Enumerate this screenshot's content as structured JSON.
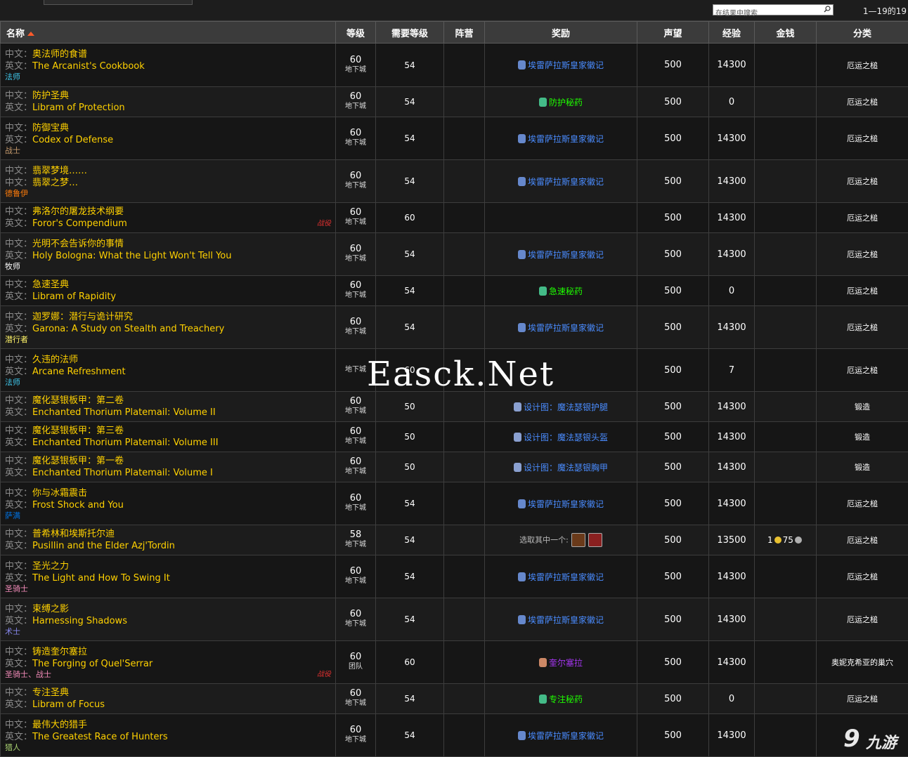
{
  "toolbar": {
    "search_placeholder": "在结果中搜索",
    "pager": "1—19的19"
  },
  "columns": [
    "名称",
    "等级",
    "需要等级",
    "阵营",
    "奖励",
    "声望",
    "经验",
    "金钱",
    "分类"
  ],
  "prefix": {
    "zh": "中文：",
    "en": "英文："
  },
  "rows": [
    {
      "zh": "奥法师的食谱",
      "en": "The Arcanist's Cookbook",
      "cls": "法师",
      "cls_color": "#3fc7eb",
      "tag": "",
      "level": "60",
      "level_sub": "地下城",
      "req": "54",
      "faction": "",
      "reward": "埃雷萨拉斯皇家徽记",
      "reward_color": "#4a8cff",
      "reward_icon": "#6688cc",
      "rep": "500",
      "xp": "14300",
      "money": "",
      "cat": "厄运之槌"
    },
    {
      "zh": "防护圣典",
      "en": "Libram of Protection",
      "pfx2": "英文：",
      "cls": "",
      "cls_color": "#fff",
      "tag": "",
      "level": "60",
      "level_sub": "地下城",
      "req": "54",
      "faction": "",
      "reward": "防护秘药",
      "reward_color": "#1eff00",
      "reward_icon": "#4b8",
      "rep": "500",
      "xp": "0",
      "money": "",
      "cat": "厄运之槌"
    },
    {
      "zh": "防御宝典",
      "en": "Codex of Defense",
      "cls": "战士",
      "cls_color": "#c69b6d",
      "tag": "",
      "level": "60",
      "level_sub": "地下城",
      "req": "54",
      "faction": "",
      "reward": "埃雷萨拉斯皇家徽记",
      "reward_color": "#4a8cff",
      "reward_icon": "#6688cc",
      "rep": "500",
      "xp": "14300",
      "money": "",
      "cat": "厄运之槌"
    },
    {
      "zh": "翡翠梦境……",
      "en": "翡翠之梦…",
      "en_pfx": "中文：",
      "cls": "德鲁伊",
      "cls_color": "#ff7c0a",
      "tag": "",
      "level": "60",
      "level_sub": "地下城",
      "req": "54",
      "faction": "",
      "reward": "埃雷萨拉斯皇家徽记",
      "reward_color": "#4a8cff",
      "reward_icon": "#6688cc",
      "rep": "500",
      "xp": "14300",
      "money": "",
      "cat": "厄运之槌"
    },
    {
      "zh": "弗洛尔的屠龙技术纲要",
      "en": "Foror's Compendium",
      "cls": "",
      "cls_color": "#fff",
      "tag": "战役",
      "level": "60",
      "level_sub": "地下城",
      "req": "60",
      "faction": "",
      "reward": "",
      "reward_color": "#4a8cff",
      "reward_icon": "",
      "rep": "500",
      "xp": "14300",
      "money": "",
      "cat": "厄运之槌"
    },
    {
      "zh": "光明不会告诉你的事情",
      "en": "Holy Bologna:  What the Light Won't Tell You",
      "cls": "牧师",
      "cls_color": "#ffffff",
      "tag": "",
      "level": "60",
      "level_sub": "地下城",
      "req": "54",
      "faction": "",
      "reward": "埃雷萨拉斯皇家徽记",
      "reward_color": "#4a8cff",
      "reward_icon": "#6688cc",
      "rep": "500",
      "xp": "14300",
      "money": "",
      "cat": "厄运之槌"
    },
    {
      "zh": "急速圣典",
      "en": "Libram of Rapidity",
      "cls": "",
      "cls_color": "#fff",
      "tag": "",
      "level": "60",
      "level_sub": "地下城",
      "req": "54",
      "faction": "",
      "reward": "急速秘药",
      "reward_color": "#1eff00",
      "reward_icon": "#4b8",
      "rep": "500",
      "xp": "0",
      "money": "",
      "cat": "厄运之槌"
    },
    {
      "zh": "迦罗娜：潜行与诡计研究",
      "en": "Garona:  A Study on Stealth and Treachery",
      "cls": "潜行者",
      "cls_color": "#fff468",
      "tag": "",
      "level": "60",
      "level_sub": "地下城",
      "req": "54",
      "faction": "",
      "reward": "埃雷萨拉斯皇家徽记",
      "reward_color": "#4a8cff",
      "reward_icon": "#6688cc",
      "rep": "500",
      "xp": "14300",
      "money": "",
      "cat": "厄运之槌"
    },
    {
      "zh": "久违的法师",
      "en": "Arcane Refreshment",
      "cls": "法师",
      "cls_color": "#3fc7eb",
      "tag": "",
      "level": "",
      "level_sub": "地下城",
      "req": "60",
      "faction": "",
      "reward": "",
      "reward_color": "#4a8cff",
      "reward_icon": "",
      "rep": "500",
      "xp": "7",
      "money": "",
      "cat": "厄运之槌"
    },
    {
      "zh": "魔化瑟银板甲：第二卷",
      "en": "Enchanted Thorium Platemail:  Volume II",
      "cls": "",
      "cls_color": "#fff",
      "tag": "",
      "level": "60",
      "level_sub": "地下城",
      "req": "50",
      "faction": "",
      "reward": "设计图：魔法瑟银护腿",
      "reward_color": "#4a8cff",
      "reward_icon": "#8aa0d0",
      "rep": "500",
      "xp": "14300",
      "money": "",
      "cat": "锻造"
    },
    {
      "zh": "魔化瑟银板甲：第三卷",
      "en": "Enchanted Thorium Platemail:  Volume III",
      "cls": "",
      "cls_color": "#fff",
      "tag": "",
      "level": "60",
      "level_sub": "地下城",
      "req": "50",
      "faction": "",
      "reward": "设计图：魔法瑟银头盔",
      "reward_color": "#4a8cff",
      "reward_icon": "#8aa0d0",
      "rep": "500",
      "xp": "14300",
      "money": "",
      "cat": "锻造"
    },
    {
      "zh": "魔化瑟银板甲：第一卷",
      "en": "Enchanted Thorium Platemail:  Volume I",
      "cls": "",
      "cls_color": "#fff",
      "tag": "",
      "level": "60",
      "level_sub": "地下城",
      "req": "50",
      "faction": "",
      "reward": "设计图：魔法瑟银胸甲",
      "reward_color": "#4a8cff",
      "reward_icon": "#8aa0d0",
      "rep": "500",
      "xp": "14300",
      "money": "",
      "cat": "锻造"
    },
    {
      "zh": "你与冰霜震击",
      "en": "Frost Shock and You",
      "cls": "萨满",
      "cls_color": "#0070dd",
      "tag": "",
      "level": "60",
      "level_sub": "地下城",
      "req": "54",
      "faction": "",
      "reward": "埃雷萨拉斯皇家徽记",
      "reward_color": "#4a8cff",
      "reward_icon": "#6688cc",
      "rep": "500",
      "xp": "14300",
      "money": "",
      "cat": "厄运之槌"
    },
    {
      "zh": "普希林和埃斯托尔迪",
      "en": "Pusillin and the Elder Azj'Tordin",
      "cls": "",
      "cls_color": "#fff",
      "tag": "",
      "level": "58",
      "level_sub": "地下城",
      "req": "54",
      "faction": "",
      "reward": "",
      "reward_choose": "选取其中一个:",
      "reward_color": "#4a8cff",
      "reward_icon": "",
      "rep": "500",
      "xp": "13500",
      "money": "1",
      "money2": "75",
      "cat": "厄运之槌"
    },
    {
      "zh": "圣光之力",
      "en": "The Light and How To Swing It",
      "cls": "圣骑士",
      "cls_color": "#f48cba",
      "tag": "",
      "level": "60",
      "level_sub": "地下城",
      "req": "54",
      "faction": "",
      "reward": "埃雷萨拉斯皇家徽记",
      "reward_color": "#4a8cff",
      "reward_icon": "#6688cc",
      "rep": "500",
      "xp": "14300",
      "money": "",
      "cat": "厄运之槌"
    },
    {
      "zh": "束缚之影",
      "en": "Harnessing Shadows",
      "cls": "术士",
      "cls_color": "#8788ee",
      "tag": "",
      "level": "60",
      "level_sub": "地下城",
      "req": "54",
      "faction": "",
      "reward": "埃雷萨拉斯皇家徽记",
      "reward_color": "#4a8cff",
      "reward_icon": "#6688cc",
      "rep": "500",
      "xp": "14300",
      "money": "",
      "cat": "厄运之槌"
    },
    {
      "zh": "铸造奎尔塞拉",
      "en": "The Forging of Quel'Serrar",
      "cls": "圣骑士、战士",
      "cls_color": "#f48cba",
      "tag": "战役",
      "level": "60",
      "level_sub": "团队",
      "req": "60",
      "faction": "",
      "reward": "奎尔塞拉",
      "reward_color": "#a335ee",
      "reward_icon": "#c86",
      "rep": "500",
      "xp": "14300",
      "money": "",
      "cat": "奥妮克希亚的巢穴"
    },
    {
      "zh": "专注圣典",
      "en": "Libram of Focus",
      "cls": "",
      "cls_color": "#fff",
      "tag": "",
      "level": "60",
      "level_sub": "地下城",
      "req": "54",
      "faction": "",
      "reward": "专注秘药",
      "reward_color": "#1eff00",
      "reward_icon": "#4b8",
      "rep": "500",
      "xp": "0",
      "money": "",
      "cat": "厄运之槌"
    },
    {
      "zh": "最伟大的猎手",
      "en": "The Greatest Race of Hunters",
      "cls": "猎人",
      "cls_color": "#aad372",
      "tag": "",
      "level": "60",
      "level_sub": "地下城",
      "req": "54",
      "faction": "",
      "reward": "埃雷萨拉斯皇家徽记",
      "reward_color": "#4a8cff",
      "reward_icon": "#6688cc",
      "rep": "500",
      "xp": "14300",
      "money": "",
      "cat": ""
    }
  ],
  "watermark": "Easck.Net",
  "logo_text": "九游"
}
